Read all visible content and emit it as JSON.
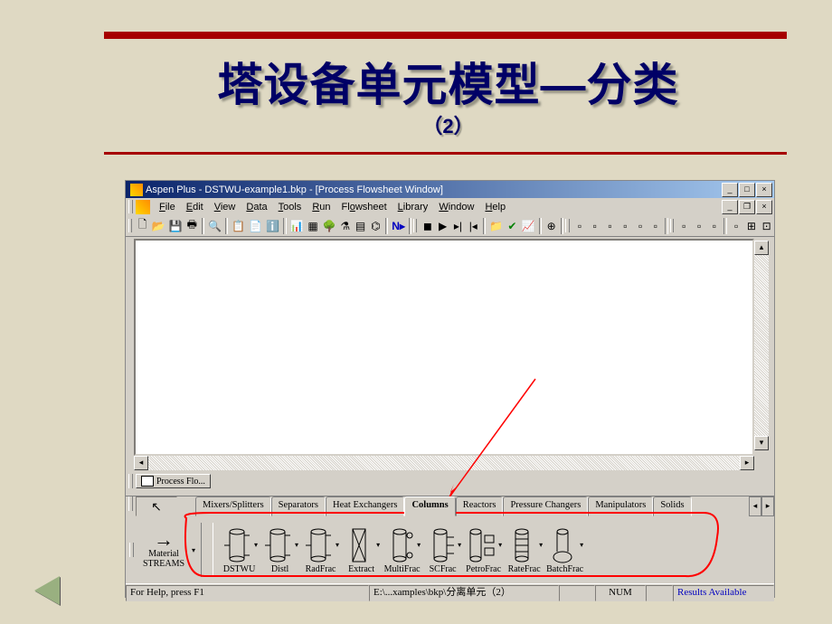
{
  "slide": {
    "title": "塔设备单元模型—分类",
    "subtitle": "（2）"
  },
  "window": {
    "title": "Aspen Plus - DSTWU-example1.bkp - [Process Flowsheet Window]"
  },
  "menus": {
    "file": "File",
    "edit": "Edit",
    "view": "View",
    "data": "Data",
    "tools": "Tools",
    "run": "Run",
    "flowsheet": "Flowsheet",
    "library": "Library",
    "window": "Window",
    "help": "Help"
  },
  "flowTab": {
    "label": "Process Flo..."
  },
  "palette": {
    "streams_line1": "Material",
    "streams_line2": "STREAMS",
    "tabs": {
      "mixers": "Mixers/Splitters",
      "separators": "Separators",
      "heatex": "Heat Exchangers",
      "columns": "Columns",
      "reactors": "Reactors",
      "pressure": "Pressure Changers",
      "manipulators": "Manipulators",
      "solids": "Solids"
    },
    "blocks": {
      "dstwu": "DSTWU",
      "distl": "Distl",
      "radfrac": "RadFrac",
      "extract": "Extract",
      "multifrac": "MultiFrac",
      "scfrac": "SCFrac",
      "petrofrac": "PetroFrac",
      "ratefrac": "RateFrac",
      "batchfrac": "BatchFrac"
    }
  },
  "statusbar": {
    "help": "For Help, press F1",
    "path": "E:\\...xamples\\bkp\\分离单元（2）",
    "num": "NUM",
    "results": "Results Available"
  },
  "colors": {
    "title_blue": "#000066",
    "accent_red": "#A60000",
    "slide_bg": "#DFD9C3",
    "annotation_red": "#FF0000",
    "annotation_arrow": "#FF0000"
  },
  "annotation": {
    "type": "arrow_and_circle",
    "target_tab": "Columns"
  }
}
